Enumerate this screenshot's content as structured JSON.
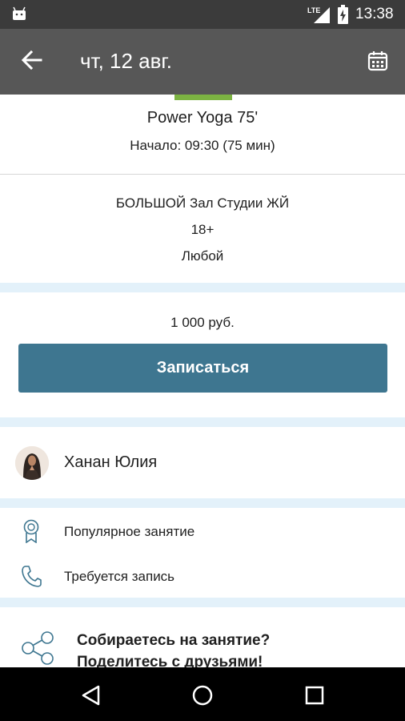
{
  "status_bar": {
    "time": "13:38",
    "network": "LTE"
  },
  "app_bar": {
    "title": "чт, 12 авг."
  },
  "class_info": {
    "title": "Power Yoga 75'",
    "start": "Начало: 09:30 (75 мин)",
    "hall": "БОЛЬШОЙ Зал Студии ЖЙ",
    "age": "18+",
    "level": "Любой"
  },
  "booking": {
    "price": "1 000 руб.",
    "button_label": "Записаться"
  },
  "trainer": {
    "name": "Ханан Юлия"
  },
  "features": [
    {
      "icon": "award-icon",
      "label": "Популярное занятие"
    },
    {
      "icon": "phone-icon",
      "label": "Требуется запись"
    }
  ],
  "share": {
    "line1": "Собираетесь на занятие?",
    "line2": "Поделитесь с друзьями!"
  },
  "colors": {
    "accent": "#3e7690",
    "app_bar": "#575757",
    "separator": "#e3f1fa",
    "indicator": "#7cb342"
  }
}
